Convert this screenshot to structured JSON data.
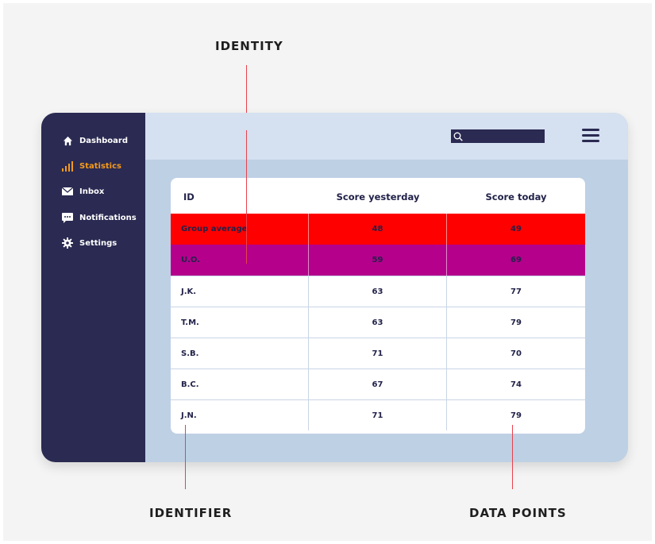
{
  "annotations": {
    "identity": "IDENTITY",
    "identifier": "IDENTIFIER",
    "data_points": "DATA POINTS",
    "line_color": "#e8424c"
  },
  "sidebar": {
    "items": [
      {
        "label": "Dashboard",
        "icon": "home-icon",
        "active": false
      },
      {
        "label": "Statistics",
        "icon": "bar-chart-icon",
        "active": true
      },
      {
        "label": "Inbox",
        "icon": "mail-icon",
        "active": false
      },
      {
        "label": "Notifications",
        "icon": "chat-bubble-icon",
        "active": false
      },
      {
        "label": "Settings",
        "icon": "gear-icon",
        "active": false
      }
    ],
    "active_color": "#f49a1c"
  },
  "topbar": {
    "search": {
      "value": "",
      "placeholder": ""
    },
    "menu_icon": "hamburger-menu-icon"
  },
  "table": {
    "headers": [
      "ID",
      "Score yesterday",
      "Score today"
    ],
    "rows": [
      {
        "id": "Group average",
        "yesterday": "48",
        "today": "49",
        "highlight": "#ff0000"
      },
      {
        "id": "U.O.",
        "yesterday": "59",
        "today": "69",
        "highlight": "#b5008c"
      },
      {
        "id": "J.K.",
        "yesterday": "63",
        "today": "77"
      },
      {
        "id": "T.M.",
        "yesterday": "63",
        "today": "79"
      },
      {
        "id": "S.B.",
        "yesterday": "71",
        "today": "70"
      },
      {
        "id": "B.C.",
        "yesterday": "67",
        "today": "74"
      },
      {
        "id": "J.N.",
        "yesterday": "71",
        "today": "79"
      }
    ]
  },
  "colors": {
    "sidebar_bg": "#2a2a52",
    "topbar_bg": "#d5e0f0",
    "content_bg": "#bed0e4",
    "text_dark": "#22224a"
  }
}
